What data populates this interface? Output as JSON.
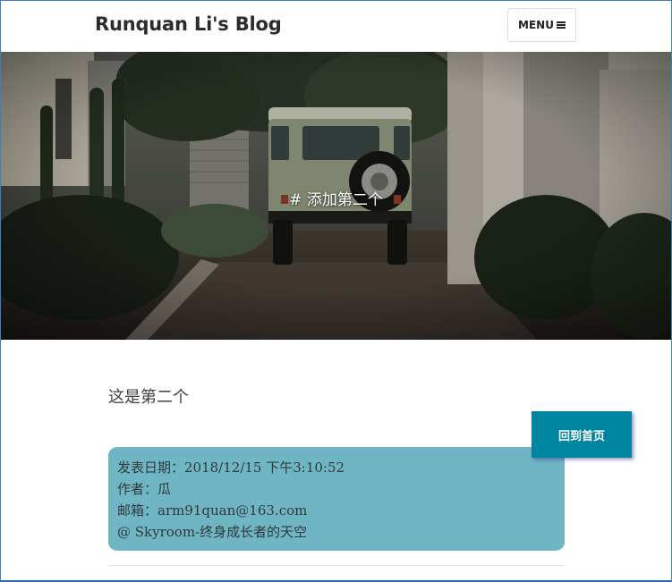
{
  "navbar": {
    "brand": "Runquan Li's Blog",
    "menu_label": "MENU"
  },
  "hero": {
    "title": "# 添加第二个"
  },
  "post": {
    "content": "这是第二个"
  },
  "home_button": {
    "label": "回到首页",
    "color": "#0085a1"
  },
  "info": {
    "date": "发表日期：2018/12/15 下午3:10:52",
    "author": "作者：瓜",
    "email": "邮箱：arm91quan@163.com",
    "site": "@ Skyroom-终身成长者的天空",
    "color": "#6fb5c4"
  }
}
